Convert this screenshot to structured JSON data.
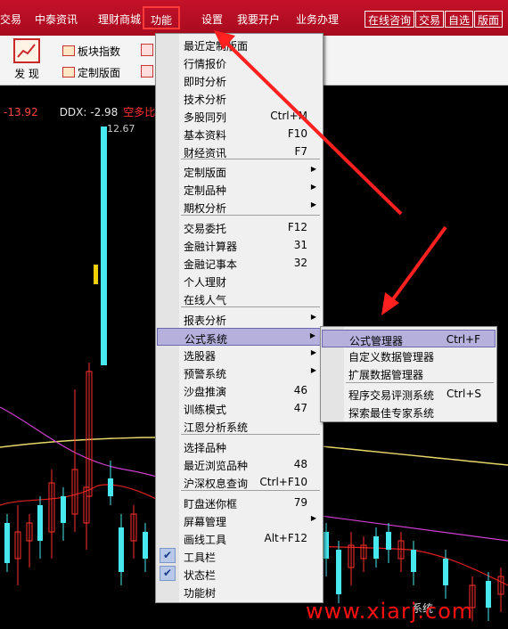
{
  "menubar": {
    "items": [
      "交易",
      "中泰资讯",
      "理财商城",
      "功能",
      "设置",
      "我要开户",
      "业务办理"
    ],
    "right_buttons": [
      "在线咨询",
      "交易",
      "自选",
      "版面"
    ]
  },
  "toolbar": {
    "find_label": "发 现",
    "sector_index": "板块指数",
    "custom_layout": "定制版面"
  },
  "chart": {
    "hud_value1": "-13.92",
    "hud_ddx": "DDX: -2.98",
    "hud_ratio": "空多比:",
    "peak_label": "12.67"
  },
  "menu": {
    "items": [
      {
        "label": "最近定制版面",
        "shortcut": ""
      },
      {
        "label": "行情报价",
        "shortcut": ""
      },
      {
        "label": "即时分析",
        "shortcut": ""
      },
      {
        "label": "技术分析",
        "shortcut": ""
      },
      {
        "label": "多股同列",
        "shortcut": "Ctrl+M"
      },
      {
        "label": "基本资料",
        "shortcut": "F10"
      },
      {
        "label": "财经资讯",
        "shortcut": "F7"
      },
      {
        "label": "定制版面",
        "shortcut": ""
      },
      {
        "label": "定制品种",
        "shortcut": ""
      },
      {
        "label": "期权分析",
        "shortcut": ""
      },
      {
        "label": "交易委托",
        "shortcut": "F12"
      },
      {
        "label": "金融计算器",
        "shortcut": "31"
      },
      {
        "label": "金融记事本",
        "shortcut": "32"
      },
      {
        "label": "个人理财",
        "shortcut": ""
      },
      {
        "label": "在线人气",
        "shortcut": ""
      },
      {
        "label": "报表分析",
        "shortcut": ""
      },
      {
        "label": "公式系统",
        "shortcut": ""
      },
      {
        "label": "选股器",
        "shortcut": ""
      },
      {
        "label": "预警系统",
        "shortcut": ""
      },
      {
        "label": "沙盘推演",
        "shortcut": "46"
      },
      {
        "label": "训练模式",
        "shortcut": "47"
      },
      {
        "label": "江恩分析系统",
        "shortcut": ""
      },
      {
        "label": "选择品种",
        "shortcut": ""
      },
      {
        "label": "最近浏览品种",
        "shortcut": "48"
      },
      {
        "label": "沪深权息查询",
        "shortcut": "Ctrl+F10"
      },
      {
        "label": "盯盘迷你框",
        "shortcut": "79"
      },
      {
        "label": "屏幕管理",
        "shortcut": ""
      },
      {
        "label": "画线工具",
        "shortcut": "Alt+F12"
      },
      {
        "label": "工具栏",
        "shortcut": ""
      },
      {
        "label": "状态栏",
        "shortcut": ""
      },
      {
        "label": "功能树",
        "shortcut": ""
      }
    ]
  },
  "submenu": {
    "items": [
      {
        "label": "公式管理器",
        "shortcut": "Ctrl+F"
      },
      {
        "label": "自定义数据管理器",
        "shortcut": ""
      },
      {
        "label": "扩展数据管理器",
        "shortcut": ""
      },
      {
        "label": "程序交易评测系统",
        "shortcut": "Ctrl+S"
      },
      {
        "label": "探索最佳专家系统",
        "shortcut": ""
      }
    ]
  },
  "watermark": {
    "text": "www.xiarj.com",
    "small": "系统"
  },
  "colors": {
    "menubar": "#b30f24",
    "highlight": "#b5b0dc",
    "annotation_arrow": "#ff2020",
    "accent_line": "#ff4040"
  }
}
